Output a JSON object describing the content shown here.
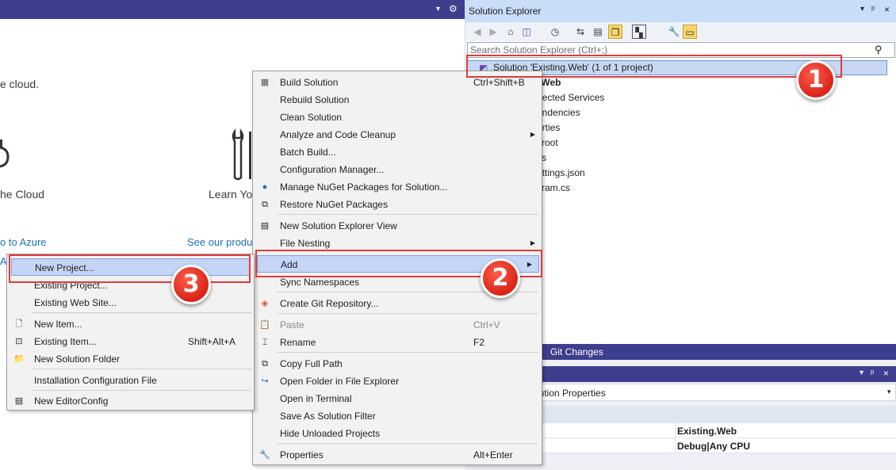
{
  "top_bar": {
    "pin": "▾",
    "gear": "⚙"
  },
  "start_page": {
    "line1": "e cloud.",
    "card1_title": "he Cloud",
    "card2_title": "Learn Yo",
    "link1": "o to Azure",
    "link2": "See our produ",
    "frag": "AS"
  },
  "solution_explorer": {
    "title": "Solution Explorer",
    "title_controls": [
      "▾",
      "ᵖ",
      "×"
    ],
    "search_placeholder": "Search Solution Explorer (Ctrl+;)",
    "solution_label": "Solution 'Existing.Web' (1 of 1 project)",
    "tree": [
      ".Web",
      "nected Services",
      "endencies",
      "erties",
      "root",
      "s",
      "ettings.json",
      "ram.cs"
    ]
  },
  "tabs": {
    "git_changes": "Git Changes"
  },
  "properties": {
    "title_controls": [
      "▾",
      "ᵖ",
      "×"
    ],
    "object": "lution Properties",
    "rows": [
      {
        "value": "Existing.Web"
      },
      {
        "value": "Debug|Any CPU"
      }
    ]
  },
  "main_menu": {
    "items": [
      {
        "label": "Build Solution",
        "shortcut": "Ctrl+Shift+B",
        "icon": "build-icon"
      },
      {
        "label": "Rebuild Solution"
      },
      {
        "label": "Clean Solution"
      },
      {
        "label": "Analyze and Code Cleanup",
        "submenu": true
      },
      {
        "label": "Batch Build..."
      },
      {
        "label": "Configuration Manager..."
      },
      {
        "label": "Manage NuGet Packages for Solution...",
        "icon": "nuget-icon"
      },
      {
        "label": "Restore NuGet Packages",
        "icon": "restore-icon"
      },
      {
        "label": "New Solution Explorer View",
        "icon": "new-view-icon"
      },
      {
        "label": "File Nesting",
        "submenu": true
      },
      {
        "label": "Add",
        "submenu": true
      },
      {
        "label": "Sync Namespaces"
      },
      {
        "label": "Create Git Repository...",
        "icon": "git-icon"
      },
      {
        "label": "Paste",
        "shortcut": "Ctrl+V",
        "disabled": true,
        "icon": "paste-icon"
      },
      {
        "label": "Rename",
        "shortcut": "F2",
        "icon": "rename-icon"
      },
      {
        "label": "Copy Full Path",
        "icon": "copy-icon"
      },
      {
        "label": "Open Folder in File Explorer",
        "icon": "folder-open-icon"
      },
      {
        "label": "Open in Terminal",
        "icon": "terminal-icon"
      },
      {
        "label": "Save As Solution Filter"
      },
      {
        "label": "Hide Unloaded Projects"
      },
      {
        "label": "Properties",
        "shortcut": "Alt+Enter",
        "icon": "wrench-icon"
      }
    ]
  },
  "add_menu": {
    "items": [
      {
        "label": "New Project..."
      },
      {
        "label": "Existing Project..."
      },
      {
        "label": "Existing Web Site..."
      },
      {
        "label": "New Item...",
        "icon": "new-item-icon"
      },
      {
        "label": "Existing Item...",
        "shortcut": "Shift+Alt+A",
        "icon": "existing-item-icon"
      },
      {
        "label": "New Solution Folder",
        "icon": "folder-icon"
      },
      {
        "label": "Installation Configuration File"
      },
      {
        "label": "New EditorConfig",
        "icon": "editorconfig-icon"
      }
    ]
  },
  "badges": [
    "1",
    "2",
    "3"
  ],
  "colors": {
    "accent": "#3e3e8e",
    "highlight": "#c5d5f6",
    "callout": "#e23a3a",
    "badge": "#d92417"
  }
}
